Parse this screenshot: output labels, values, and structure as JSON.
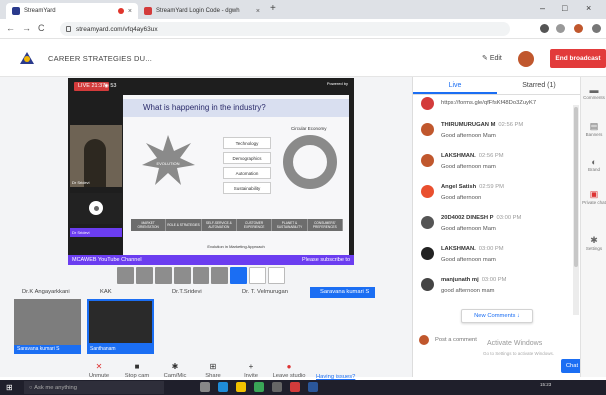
{
  "browser": {
    "tabs": [
      {
        "label": "StreamYard"
      },
      {
        "label": "StreamYard Login Code - dgwh"
      }
    ],
    "url": "streamyard.com/vfq4ay63ux",
    "window_controls": [
      "–",
      "□",
      "×"
    ]
  },
  "header": {
    "title": "CAREER STRATEGIES DU...",
    "edit_label": "Edit",
    "end_broadcast_label": "End broadcast"
  },
  "stage": {
    "live_label": "LIVE 21:37",
    "viewer_count": "53",
    "powered_by": "Powered by",
    "slide_title": "What is happening in the industry?",
    "evolution_label": "EVOLUTION",
    "box_items": [
      "Technology",
      "Demographics",
      "Automation",
      "Sustainability"
    ],
    "circular_title": "Circular Economy",
    "arrow_steps": [
      "MARKET ORIENTATION",
      "ROLE & STRATEGIES",
      "SELF-SERVICE & AUTOMATION",
      "CUSTOMER EXPERIENCE",
      "PLANET & SUSTAINABILITY",
      "CONSUMERS' PREFERENCES"
    ],
    "slide_footer": "Evolution in Marketing Approach",
    "selfcam_label": "Dr Sridevi",
    "sidebar_label": "Dr Sridevi",
    "ticker_left": "MCAWEB YouTube Channel",
    "ticker_right": "Please subscribe to"
  },
  "participants": [
    {
      "name": "Dr.K Angayarkkani"
    },
    {
      "name": "KAK"
    },
    {
      "name": "Dr.T.Sridevi"
    },
    {
      "name": "Dr. T. Velmurugan"
    },
    {
      "name": "Saravana kumari S"
    }
  ],
  "thumbnails": [
    {
      "label": "Saravana kumari S"
    },
    {
      "label": "Santhanam"
    }
  ],
  "controls": [
    {
      "label": "Unmute",
      "icon": "mic-off-icon"
    },
    {
      "label": "Stop cam",
      "icon": "camera-icon"
    },
    {
      "label": "Cam/Mic",
      "icon": "gear-icon"
    },
    {
      "label": "Share",
      "icon": "share-icon"
    },
    {
      "label": "Invite",
      "icon": "invite-icon"
    },
    {
      "label": "Leave studio",
      "icon": "leave-icon"
    }
  ],
  "having_issues": "Having issues?",
  "chat": {
    "tabs": [
      "Live",
      "Starred (1)"
    ],
    "messages": [
      {
        "name": "",
        "time": "",
        "text": "https://forms.gle/qfFfsKf48Do3ZuyK7",
        "color": "#d33b3b"
      },
      {
        "name": "THIRUMURUGAN M",
        "time": "02:56 PM",
        "text": "Good afternoon Mam",
        "color": "#c0572d"
      },
      {
        "name": "LAKSHMAN.",
        "time": "02:56 PM",
        "text": "Good afternoon mam",
        "color": "#c0572d"
      },
      {
        "name": "Angel Satish",
        "time": "02:59 PM",
        "text": "Good afternoon",
        "color": "#e94f2e"
      },
      {
        "name": "20D4002 DINESH P",
        "time": "03:00 PM",
        "text": "Good afternoon Mam",
        "color": "#555555"
      },
      {
        "name": "LAKSHMAN.",
        "time": "03:00 PM",
        "text": "Good afternoon mam",
        "color": "#222222"
      },
      {
        "name": "manjunath mj",
        "time": "03:00 PM",
        "text": "good afternoon mam",
        "color": "#444444"
      }
    ],
    "new_comments": "New Comments",
    "comment_placeholder": "Post a comment",
    "chat_button": "Chat"
  },
  "windows_watermark": {
    "title": "Activate Windows",
    "subtitle": "Go to Settings to activate Windows."
  },
  "rail": [
    {
      "label": "Comments"
    },
    {
      "label": "Banners"
    },
    {
      "label": "Brand"
    },
    {
      "label": "Private chat"
    },
    {
      "label": "Settings"
    }
  ],
  "taskbar": {
    "search_placeholder": "Ask me anything",
    "clock": "15:23"
  }
}
